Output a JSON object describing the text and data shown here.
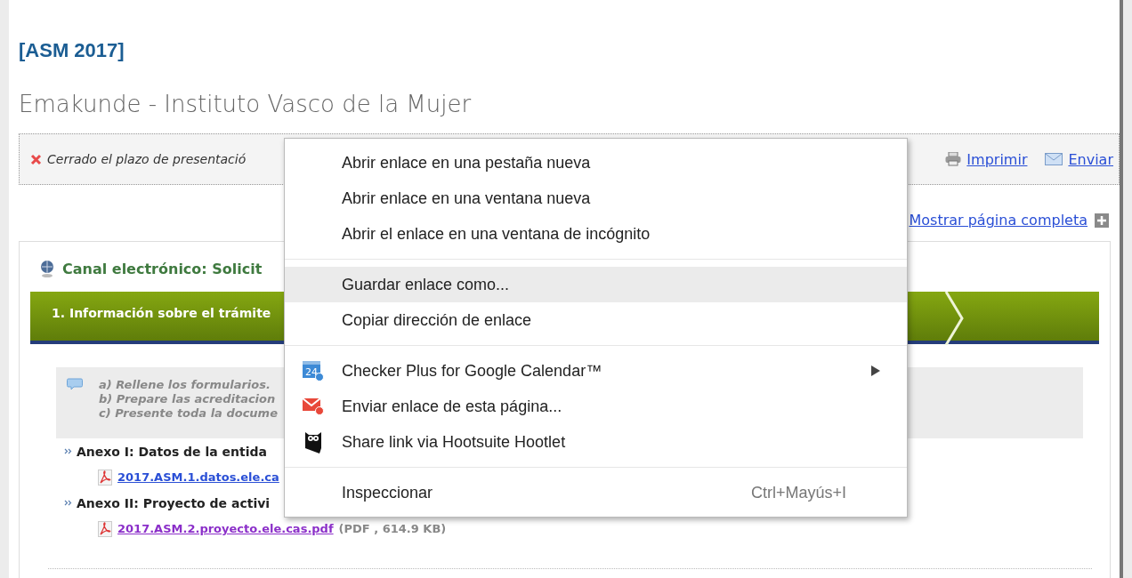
{
  "page": {
    "code": "[ASM 2017]",
    "organization": "Emakunde - Instituto Vasco de la Mujer"
  },
  "notice": {
    "text": "Cerrado el plazo de presentació",
    "actions": [
      {
        "kind": "print",
        "label": "Imprimir"
      },
      {
        "kind": "mail",
        "label": "Enviar"
      }
    ]
  },
  "show_full_page": "Mostrar página completa",
  "panel": {
    "title": "Canal electrónico: Solicit",
    "steps": [
      {
        "label": "1. Información sobre el trámite",
        "selected": true
      }
    ],
    "instructions": [
      "a) Rellene los formularios.",
      "b) Prepare las acreditacion",
      "c) Presente toda la docume"
    ],
    "annexes": [
      {
        "title": "Anexo I: Datos de la entida",
        "file": "2017.ASM.1.datos.ele.ca",
        "visited": false
      },
      {
        "title": "Anexo II: Proyecto de activi",
        "file": "2017.ASM.2.proyecto.ele.cas.pdf",
        "size": "(PDF , 614.9 KB)",
        "visited": true
      }
    ]
  },
  "context_menu": {
    "groups": [
      [
        {
          "label": "Abrir enlace en una pestaña nueva",
          "selected": false
        },
        {
          "label": "Abrir enlace en una ventana nueva",
          "selected": false
        },
        {
          "label": "Abrir el enlace en una ventana de incógnito",
          "selected": false
        }
      ],
      [
        {
          "label": "Guardar enlace como...",
          "selected": true
        },
        {
          "label": "Copiar dirección de enlace",
          "selected": false
        }
      ],
      [
        {
          "label": "Checker Plus for Google Calendar™",
          "selected": false,
          "kind": "calendar",
          "icon_text": "24",
          "submenu": true
        },
        {
          "label": "Enviar enlace de esta página...",
          "selected": false,
          "kind": "mail"
        },
        {
          "label": "Share link via Hootsuite Hootlet",
          "selected": false,
          "kind": "owl"
        }
      ],
      [
        {
          "label": "Inspeccionar",
          "selected": false,
          "shortcut": "Ctrl+Mayús+I"
        }
      ]
    ]
  }
}
